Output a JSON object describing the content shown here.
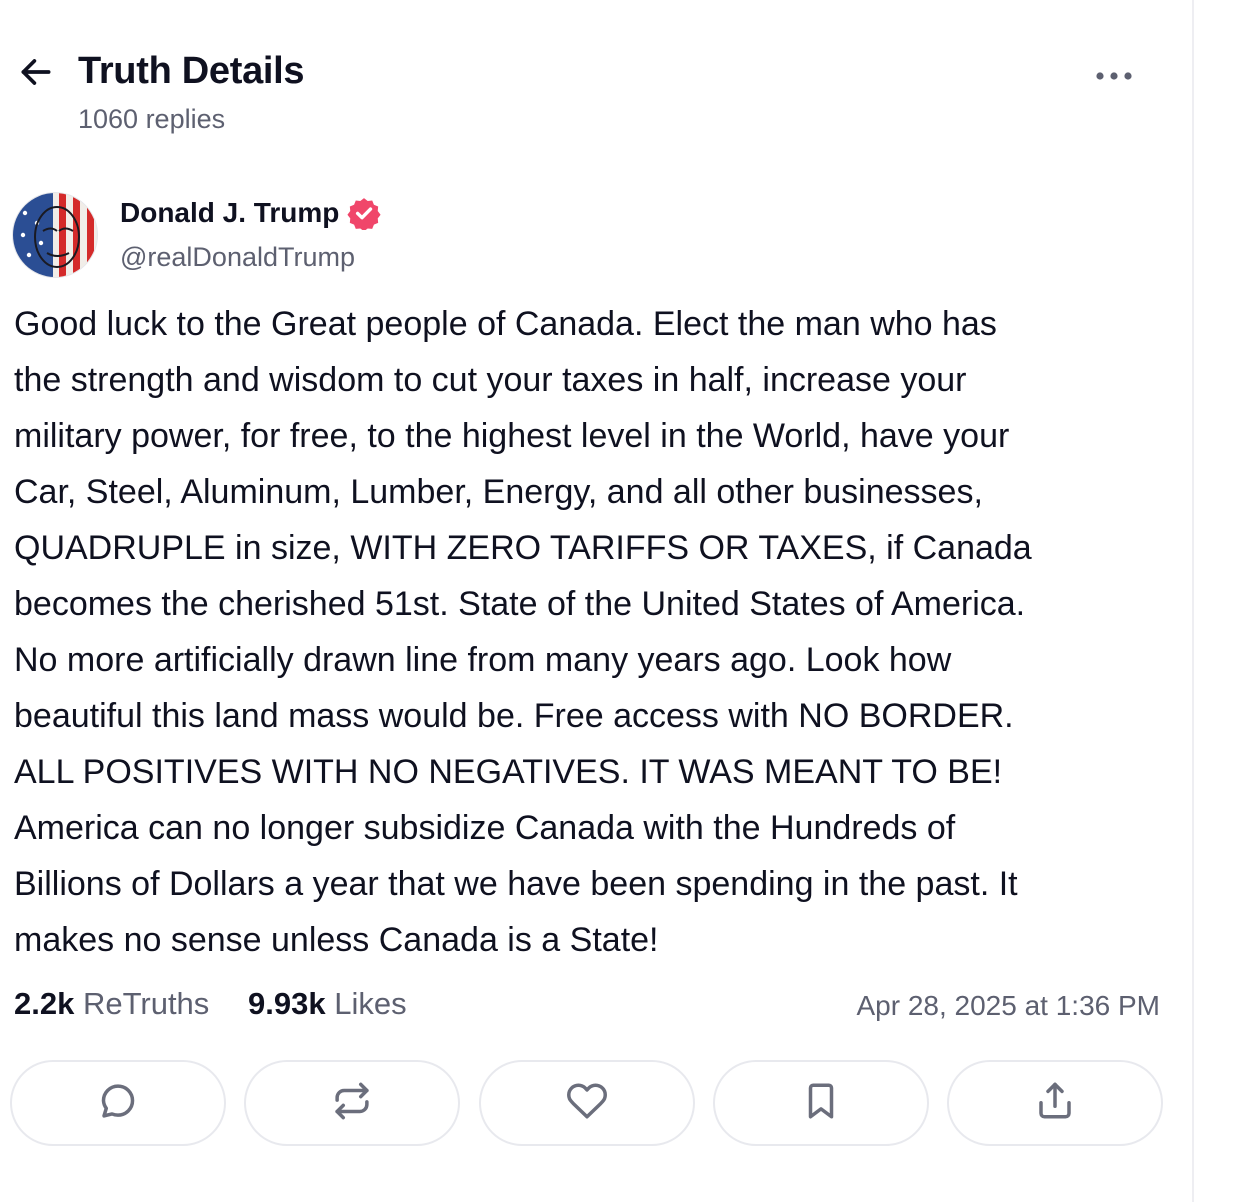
{
  "header": {
    "title": "Truth Details",
    "reply_count": "1060 replies",
    "back_icon": "arrow-left-icon",
    "more_icon": "more-horizontal-icon"
  },
  "author": {
    "name": "Donald J. Trump",
    "handle": "@realDonaldTrump",
    "verified": true,
    "verified_color": "#f0466a"
  },
  "post": {
    "lines": [
      "Good luck to the Great people of Canada. Elect the man who has",
      "the strength and wisdom to cut your taxes in half, increase your",
      "military power, for free, to the highest level in the World, have your",
      "Car, Steel, Aluminum, Lumber, Energy, and all other businesses,",
      "QUADRUPLE in size, WITH ZERO TARIFFS OR TAXES, if Canada",
      "becomes the cherished 51st. State of the United States of America.",
      "No more artificially drawn line from many years ago. Look how",
      "beautiful this land mass would be. Free access with NO BORDER.",
      "ALL POSITIVES WITH NO NEGATIVES. IT WAS MEANT TO BE!",
      "America can no longer subsidize Canada with the Hundreds of",
      "Billions of Dollars a year that we have been spending in the past. It",
      "makes no sense unless Canada is a State!"
    ]
  },
  "stats": {
    "retruths_count": "2.2k",
    "retruths_label": "ReTruths",
    "likes_count": "9.93k",
    "likes_label": "Likes",
    "timestamp": "Apr 28, 2025 at 1:36 PM"
  },
  "actions": [
    {
      "name": "reply",
      "icon": "comment-icon"
    },
    {
      "name": "retruth",
      "icon": "repost-icon"
    },
    {
      "name": "like",
      "icon": "heart-icon"
    },
    {
      "name": "bookmark",
      "icon": "bookmark-icon"
    },
    {
      "name": "share",
      "icon": "share-icon"
    }
  ],
  "colors": {
    "text": "#0f1120",
    "muted": "#5d6070",
    "border": "#e8e9ee",
    "icon": "#6b6e7c"
  }
}
